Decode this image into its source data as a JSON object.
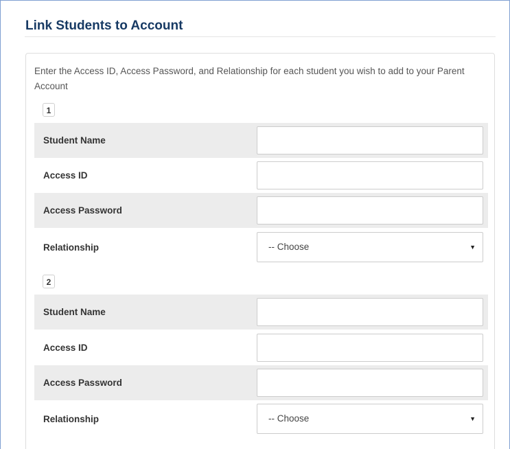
{
  "header": {
    "title": "Link Students to Account"
  },
  "instructions": "Enter the Access ID, Access Password, and Relationship for each student you wish to add to your Parent Account",
  "students": [
    {
      "number": "1",
      "fields": {
        "student_name": {
          "label": "Student Name",
          "value": ""
        },
        "access_id": {
          "label": "Access ID",
          "value": ""
        },
        "access_password": {
          "label": "Access Password",
          "value": ""
        },
        "relationship": {
          "label": "Relationship",
          "selected": "-- Choose"
        }
      }
    },
    {
      "number": "2",
      "fields": {
        "student_name": {
          "label": "Student Name",
          "value": ""
        },
        "access_id": {
          "label": "Access ID",
          "value": ""
        },
        "access_password": {
          "label": "Access Password",
          "value": ""
        },
        "relationship": {
          "label": "Relationship",
          "selected": "-- Choose"
        }
      }
    }
  ],
  "colors": {
    "title": "#173a64",
    "shaded_row": "#ececec",
    "frame_border": "#7f9fd1"
  },
  "icons": {
    "select_caret": "caret-down-icon"
  }
}
